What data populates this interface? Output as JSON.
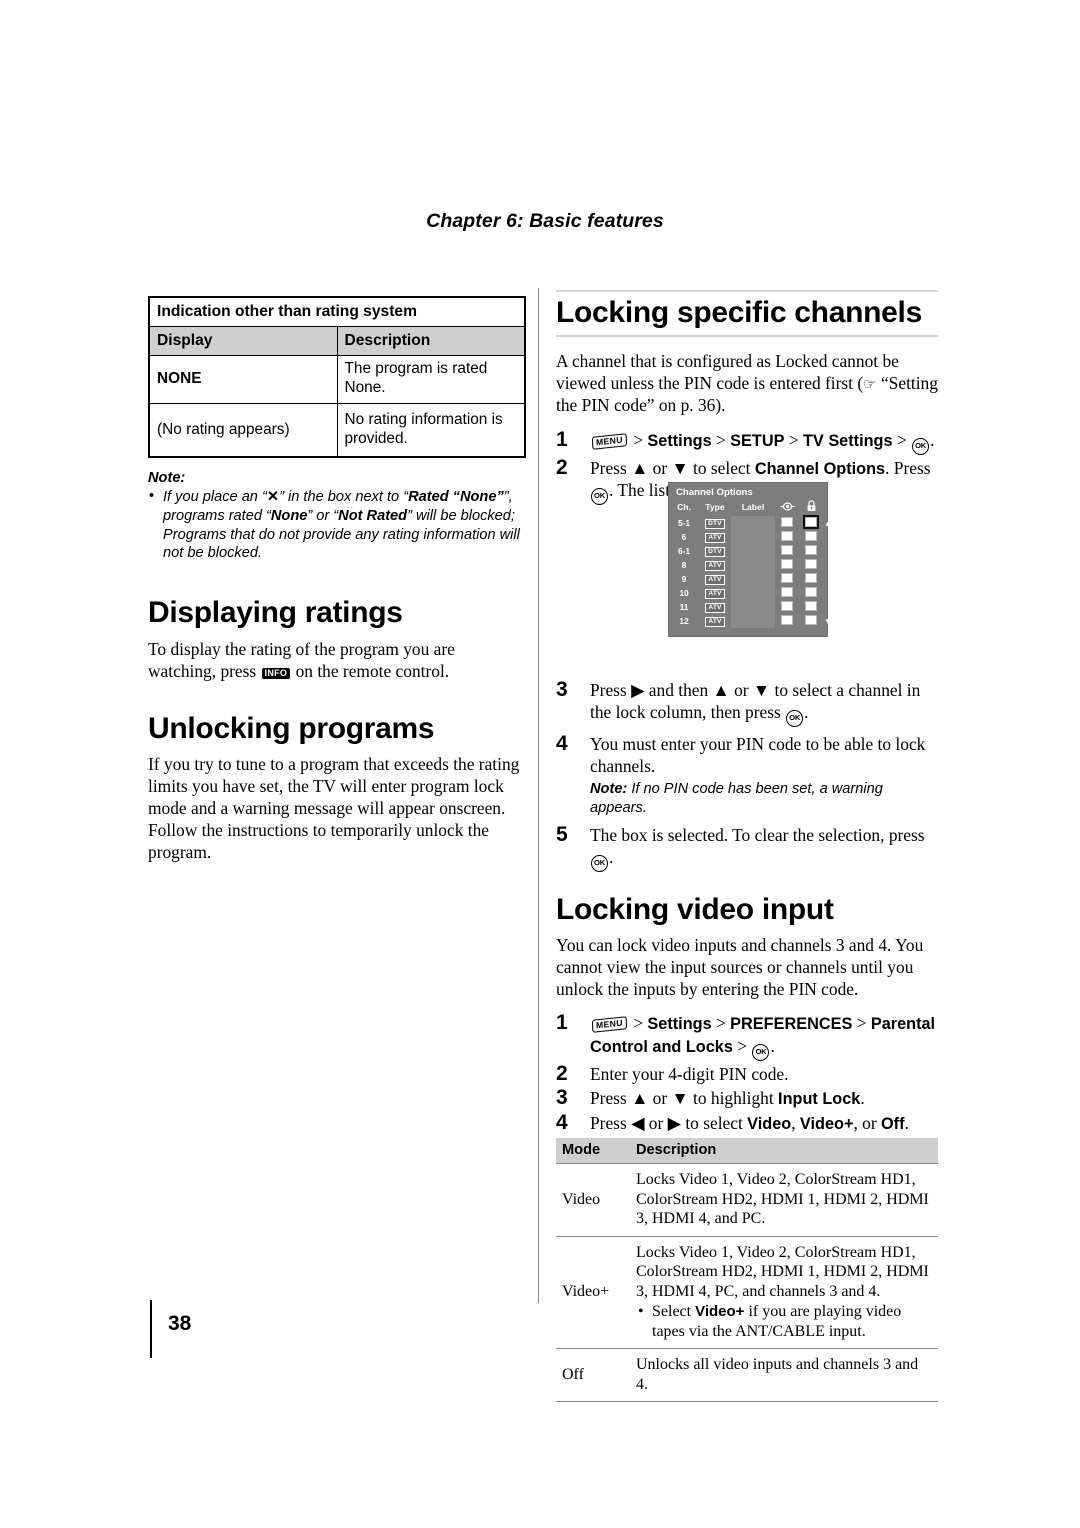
{
  "page": {
    "chapter_header": "Chapter 6: Basic features",
    "page_number": "38"
  },
  "left_column": {
    "rating_table": {
      "title": "Indication other than rating system",
      "headers": [
        "Display",
        "Description"
      ],
      "rows": [
        {
          "display": "NONE",
          "description": "The program is rated None."
        },
        {
          "display": "(No rating appears)",
          "description": "No rating information is provided."
        }
      ]
    },
    "note": {
      "label": "Note:",
      "item_1_part1": "If you place an “",
      "item_1_x": "✕",
      "item_1_part2": "” in the box next to “",
      "item_1_bold1": "Rated “None”",
      "item_1_part3": "”, programs rated “",
      "item_1_bold2": "None",
      "item_1_part4": "” or “",
      "item_1_bold3": "Not Rated",
      "item_1_part5": "” will be blocked; Programs that do not provide any rating information will not be blocked."
    },
    "displaying_ratings": {
      "heading": "Displaying ratings",
      "body_part1": "To display the rating of the program you are watching, press ",
      "info_key": "INFO",
      "body_part2": " on the remote control."
    },
    "unlocking_programs": {
      "heading": "Unlocking programs",
      "body": "If you try to tune to a program that exceeds the rating limits you have set, the TV will enter program lock mode and a warning message will appear onscreen. Follow the instructions to temporarily unlock the program."
    }
  },
  "right_column": {
    "locking_specific_channels": {
      "heading": "Locking specific channels",
      "intro_part1": "A channel that is configured as Locked cannot be viewed unless the PIN code is entered first (",
      "intro_hand": "☞",
      "intro_part2": " “Setting the PIN code” on p. 36).",
      "steps": [
        {
          "num": "1",
          "menu_key": "MENU",
          "t1": " > ",
          "b1": "Settings",
          "t2": " > ",
          "b2": "SETUP",
          "t3": " > ",
          "b3": "TV Settings",
          "t4": " > ",
          "ok": "OK",
          "t5": "."
        },
        {
          "num": "2",
          "t1": "Press ▲ or ▼ to select ",
          "b1": "Channel Options",
          "t2": ". Press ",
          "ok": "OK",
          "t3": ". The list of channels appears."
        },
        {
          "num": "3",
          "t1": "Press ▶ and then ▲ or ▼ to select a channel in the lock column, then press ",
          "ok": "OK",
          "t2": "."
        },
        {
          "num": "4",
          "t1": "You must enter your PIN code to be able to lock channels.",
          "note_label": "Note:",
          "note_text": " If no PIN code has been set, a warning appears."
        },
        {
          "num": "5",
          "t1": "The box is selected. To clear the selection, press ",
          "ok": "OK",
          "t2": "."
        }
      ]
    },
    "channel_options_figure": {
      "title": "Channel Options",
      "headers": [
        "Ch.",
        "Type",
        "Label",
        "eye-icon",
        "lock-icon"
      ],
      "scroll_up": "▲",
      "scroll_down": "▼",
      "rows": [
        {
          "ch": "5-1",
          "type": "DTV",
          "label": "",
          "view_checked": false,
          "lock_checked": false,
          "lock_selected": true
        },
        {
          "ch": "6",
          "type": "ATV",
          "label": "",
          "view_checked": false,
          "lock_checked": false,
          "lock_selected": false
        },
        {
          "ch": "6-1",
          "type": "DTV",
          "label": "",
          "view_checked": false,
          "lock_checked": false,
          "lock_selected": false
        },
        {
          "ch": "8",
          "type": "ATV",
          "label": "",
          "view_checked": false,
          "lock_checked": false,
          "lock_selected": false
        },
        {
          "ch": "9",
          "type": "ATV",
          "label": "",
          "view_checked": false,
          "lock_checked": false,
          "lock_selected": false
        },
        {
          "ch": "10",
          "type": "ATV",
          "label": "",
          "view_checked": false,
          "lock_checked": false,
          "lock_selected": false
        },
        {
          "ch": "11",
          "type": "ATV",
          "label": "",
          "view_checked": false,
          "lock_checked": false,
          "lock_selected": false
        },
        {
          "ch": "12",
          "type": "ATV",
          "label": "",
          "view_checked": false,
          "lock_checked": false,
          "lock_selected": false
        }
      ]
    },
    "locking_video_input": {
      "heading": "Locking video input",
      "intro": "You can lock video inputs and channels 3 and 4. You cannot view the input sources or channels until you unlock the inputs by entering the PIN code.",
      "steps": [
        {
          "num": "1",
          "menu_key": "MENU",
          "t1": " > ",
          "b1": "Settings",
          "t2": " > ",
          "b2": "PREFERENCES",
          "t3": " > ",
          "b3": "Parental Control and Locks",
          "t4": " > ",
          "ok": "OK",
          "t5": "."
        },
        {
          "num": "2",
          "t1": "Enter your 4-digit PIN code."
        },
        {
          "num": "3",
          "t1": "Press ▲ or ▼ to highlight ",
          "b1": "Input Lock",
          "t2": "."
        },
        {
          "num": "4",
          "t1": "Press ◀ or ▶ to select ",
          "b1": "Video",
          "t2": ", ",
          "b2": "Video+",
          "t3": ", or ",
          "b3": "Off",
          "t4": "."
        }
      ],
      "mode_table": {
        "headers": [
          "Mode",
          "Description"
        ],
        "rows": [
          {
            "mode": "Video",
            "description": "Locks Video 1, Video 2, ColorStream HD1, ColorStream HD2, HDMI 1, HDMI 2, HDMI 3, HDMI 4, and PC."
          },
          {
            "mode": "Video+",
            "description": "Locks Video 1, Video 2, ColorStream HD1, ColorStream HD2, HDMI 1, HDMI 2, HDMI 3, HDMI 4, PC, and channels 3 and 4.",
            "sub_part1": "Select ",
            "sub_bold": "Video+",
            "sub_part2": " if you are playing video tapes via the ANT/CABLE input."
          },
          {
            "mode": "Off",
            "description": "Unlocks all video inputs and channels 3 and 4."
          }
        ]
      }
    }
  },
  "colors": {
    "table_header_gray": "#cfcfcf",
    "figure_bg_gray": "#7d7d7d",
    "rule_gray": "#d3d3d3",
    "divider_gray": "#8a8a8a"
  }
}
